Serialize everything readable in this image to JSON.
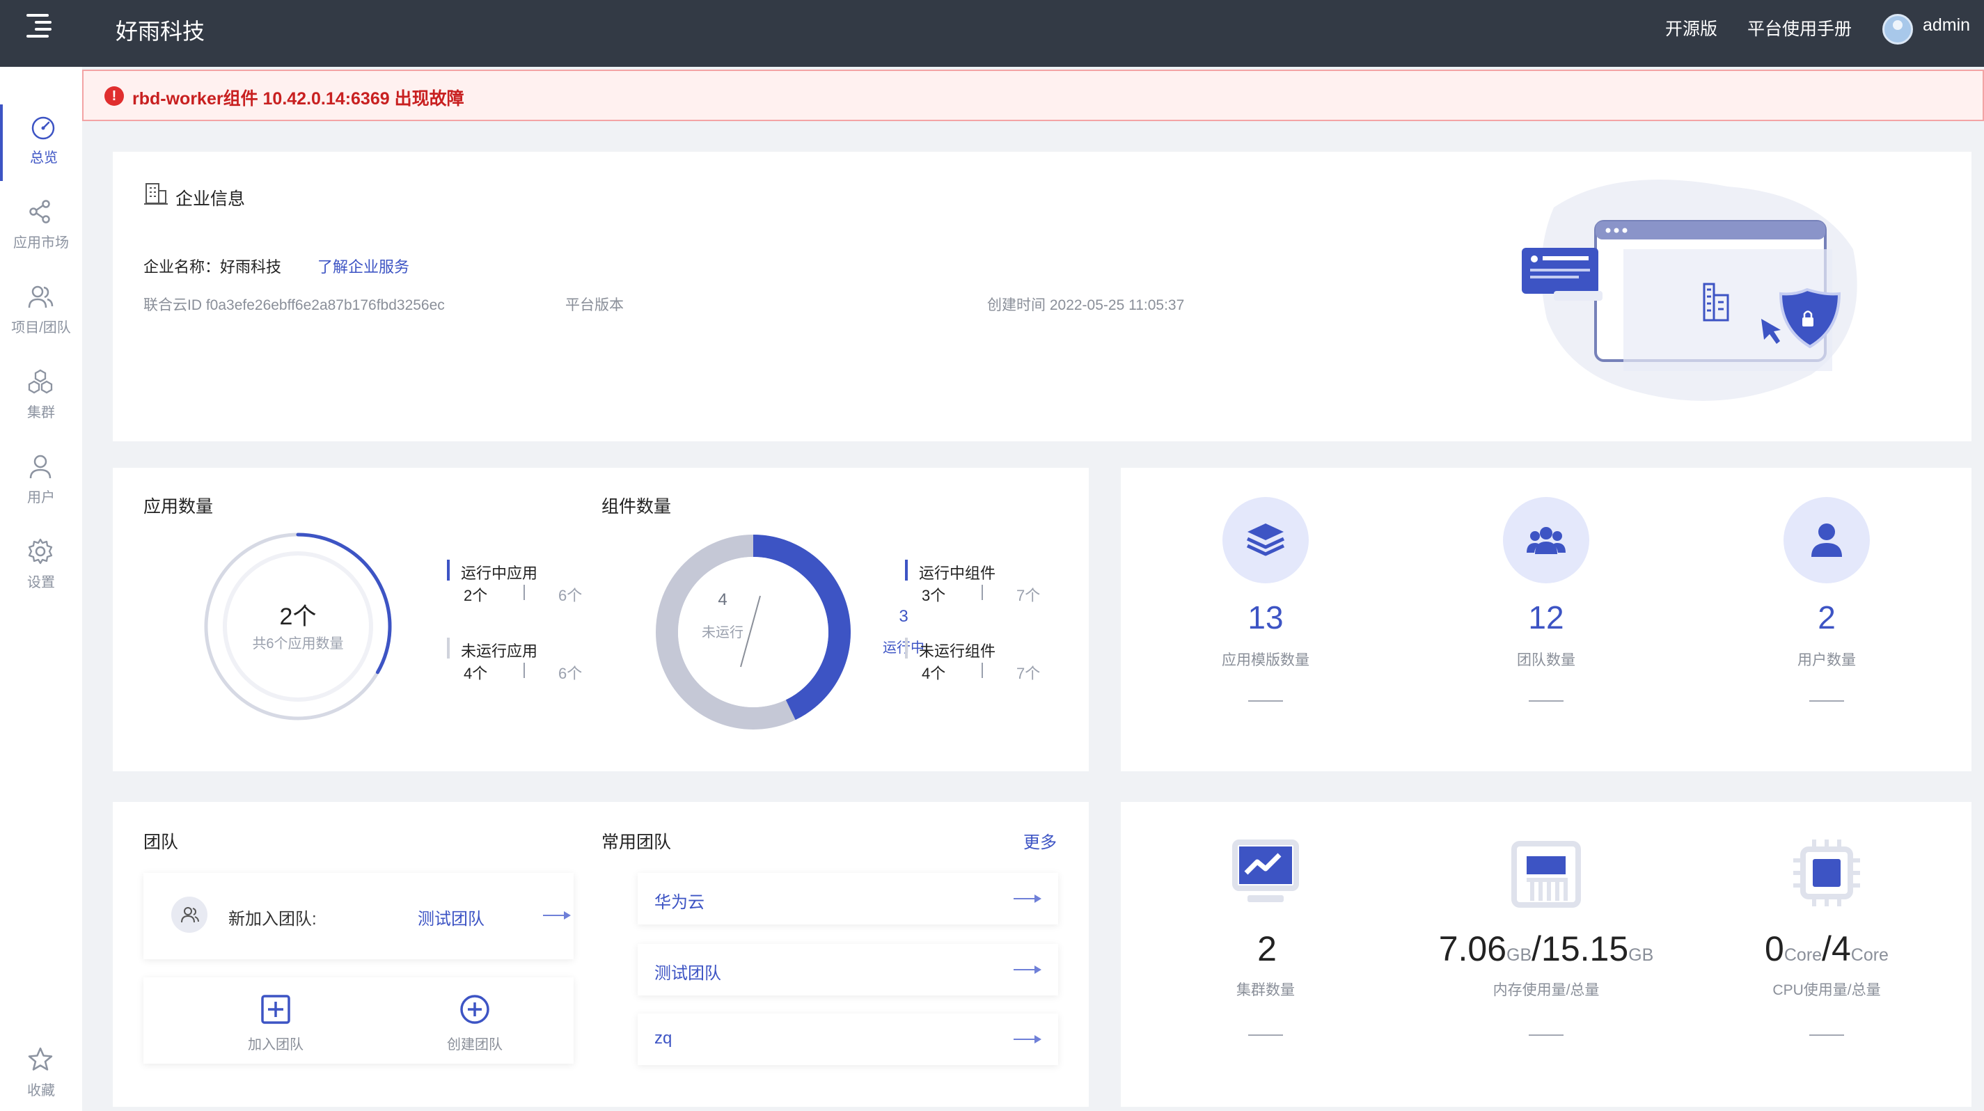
{
  "header": {
    "brand": "好雨科技",
    "links": [
      "开源版",
      "平台使用手册"
    ],
    "user": "admin"
  },
  "sidebar": {
    "items": [
      {
        "label": "总览",
        "icon": "dashboard-icon",
        "active": true
      },
      {
        "label": "应用市场",
        "icon": "share-icon"
      },
      {
        "label": "项目/团队",
        "icon": "users-icon"
      },
      {
        "label": "集群",
        "icon": "cluster-icon"
      },
      {
        "label": "用户",
        "icon": "user-icon"
      },
      {
        "label": "设置",
        "icon": "gear-icon"
      },
      {
        "label": "收藏",
        "icon": "star-icon"
      }
    ]
  },
  "alert": {
    "message": "rbd-worker组件 10.42.0.14:6369 出现故障"
  },
  "enterprise": {
    "title": "企业信息",
    "name_label": "企业名称：好雨科技",
    "service_link": "了解企业服务",
    "cloud_id": "联合云ID f0a3efe26ebff6e2a87b176fbd3256ec",
    "platform_version": "平台版本",
    "created": "创建时间 2022-05-25 11:05:37"
  },
  "apps": {
    "title": "应用数量",
    "center_main": "2个",
    "center_sub": "共6个应用数量",
    "running_fraction": 0.333,
    "legend": [
      {
        "name": "运行中应用",
        "value": "2个",
        "total": "6个",
        "color": "#3d54c4"
      },
      {
        "name": "未运行应用",
        "value": "4个",
        "total": "6个",
        "color": "#d0d3dc"
      }
    ]
  },
  "components": {
    "title": "组件数量",
    "stopped_num": "4",
    "stopped_label": "未运行",
    "running_num": "3",
    "running_label": "运行中",
    "running_fraction": 0.4286,
    "legend": [
      {
        "name": "运行中组件",
        "value": "3个",
        "total": "7个",
        "color": "#3d54c4"
      },
      {
        "name": "未运行组件",
        "value": "4个",
        "total": "7个",
        "color": "#d0d3dc"
      }
    ]
  },
  "stats": [
    {
      "num": "13",
      "label": "应用模版数量",
      "icon": "layers-icon"
    },
    {
      "num": "12",
      "label": "团队数量",
      "icon": "team-icon"
    },
    {
      "num": "2",
      "label": "用户数量",
      "icon": "user-icon"
    }
  ],
  "teams": {
    "title": "团队",
    "new_join_label": "新加入团队:",
    "new_join_team": "测试团队",
    "join_label": "加入团队",
    "create_label": "创建团队",
    "common_title": "常用团队",
    "more": "更多",
    "common": [
      "华为云",
      "测试团队",
      "zq"
    ]
  },
  "resources": [
    {
      "value": "2",
      "label": "集群数量",
      "icon": "monitor-icon"
    },
    {
      "used": "7.06",
      "used_unit": "GB",
      "total": "15.15",
      "total_unit": "GB",
      "label": "内存使用量/总量",
      "icon": "memory-icon"
    },
    {
      "used": "0",
      "used_unit": "Core",
      "total": "4",
      "total_unit": "Core",
      "label": "CPU使用量/总量",
      "icon": "cpu-icon"
    }
  ],
  "colors": {
    "accent": "#3d54c4",
    "header_bg": "#333a45",
    "alert_text": "#c82020"
  }
}
